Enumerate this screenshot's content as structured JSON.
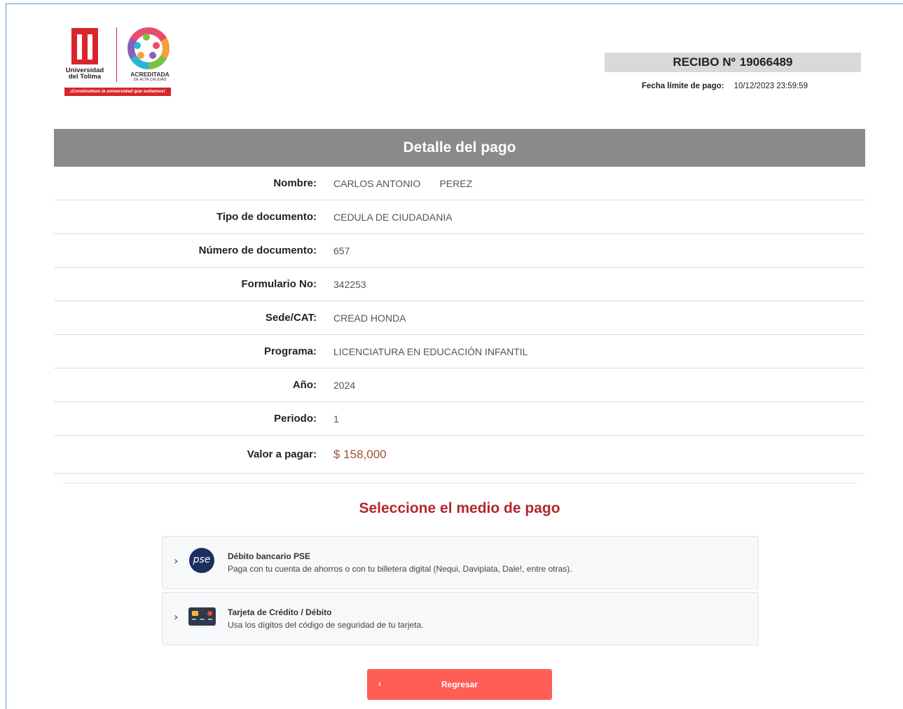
{
  "logo": {
    "university_name": "Universidad del Tolima",
    "accreditation": "ACREDITADA",
    "accreditation_sub": "DE ALTA CALIDAD",
    "slogan": "¡Construimos la universidad que soñamos!"
  },
  "receipt": {
    "label": "RECIBO Nº",
    "number": "19066489",
    "due_label": "Fecha límite de pago:",
    "due_value": "10/12/2023 23:59:59"
  },
  "detail": {
    "title": "Detalle del pago",
    "rows": [
      {
        "label": "Nombre:",
        "value": "CARLOS ANTONIO       PEREZ"
      },
      {
        "label": "Tipo de documento:",
        "value": "CEDULA DE CIUDADANIA"
      },
      {
        "label": "Número de documento:",
        "value": "657"
      },
      {
        "label": "Formulario No:",
        "value": "342253"
      },
      {
        "label": "Sede/CAT:",
        "value": "CREAD HONDA"
      },
      {
        "label": "Programa:",
        "value": "LICENCIATURA EN EDUCACIÓN INFANTIL"
      },
      {
        "label": "Año:",
        "value": "2024"
      },
      {
        "label": "Periodo:",
        "value": "1"
      },
      {
        "label": "Valor a pagar:",
        "value": "$ 158,000"
      }
    ]
  },
  "payment": {
    "title": "Seleccione el medio de pago",
    "methods": [
      {
        "title": "Débito bancario PSE",
        "description": "Paga con tu cuenta de ahorros o con tu billetera digital (Nequi, Daviplata, Dale!, entre otras).",
        "icon": "pse-icon",
        "icon_text": "pse"
      },
      {
        "title": "Tarjeta de Crédito / Débito",
        "description": "Usa los dígitos del código de seguridad de tu tarjeta.",
        "icon": "credit-card-icon"
      }
    ]
  },
  "back_button": {
    "label": "Regresar"
  },
  "colors": {
    "accent": "#b3272f",
    "button": "#ff5e57",
    "header_bar": "#8a8a8a",
    "brand_red": "#d7262b"
  }
}
